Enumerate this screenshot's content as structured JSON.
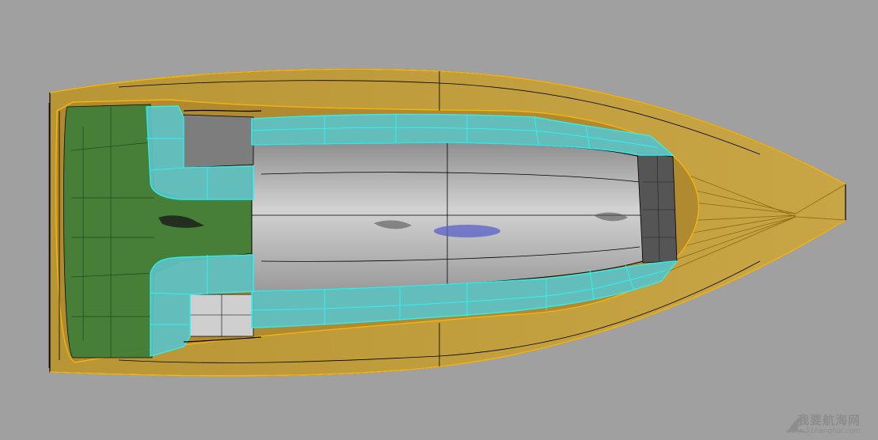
{
  "viewport": {
    "background": "#a0a0a0",
    "object": "boat-hull-top-view"
  },
  "colors": {
    "hull_fill": "#bd9a3c",
    "hull_edge": "#f3b410",
    "stern_fill": "#3f7d39",
    "selected_fill": "#5fc0c3",
    "selected_edge": "#2ef2f2",
    "cabin_fill": "#c4c4c4",
    "wire": "#000000"
  },
  "watermark": {
    "title": "我要航海网",
    "url": "www.51hanghai.com",
    "icon": "sail-logo-icon"
  }
}
